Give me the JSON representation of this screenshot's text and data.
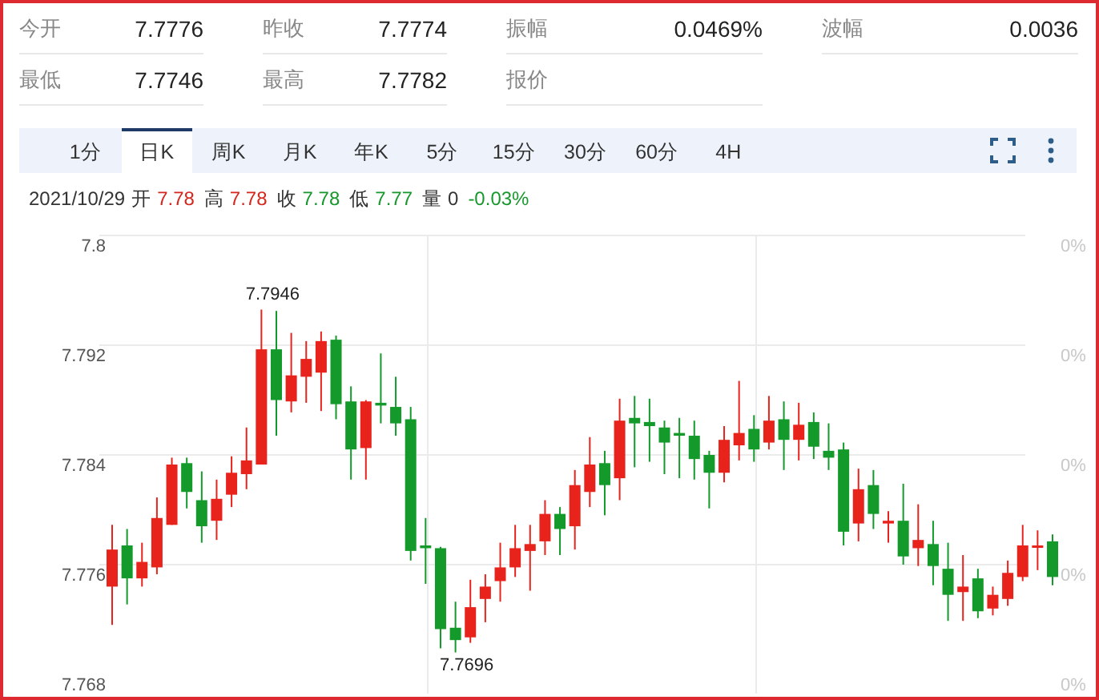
{
  "stats": [
    {
      "label": "今开",
      "value": "7.7776"
    },
    {
      "label": "昨收",
      "value": "7.7774"
    },
    {
      "label": "振幅",
      "value": "0.0469%"
    },
    {
      "label": "波幅",
      "value": "0.0036"
    },
    {
      "label": "最低",
      "value": "7.7746"
    },
    {
      "label": "最高",
      "value": "7.7782"
    },
    {
      "label": "报价"
    }
  ],
  "tabs": [
    {
      "label": "1分",
      "selected": false
    },
    {
      "label": "日K",
      "selected": true
    },
    {
      "label": "周K",
      "selected": false
    },
    {
      "label": "月K",
      "selected": false
    },
    {
      "label": "年K",
      "selected": false
    },
    {
      "label": "5分",
      "selected": false
    },
    {
      "label": "15分",
      "selected": false
    },
    {
      "label": "30分",
      "selected": false
    },
    {
      "label": "60分",
      "selected": false
    },
    {
      "label": "4H",
      "selected": false
    }
  ],
  "info": {
    "date": "2021/10/29",
    "items": [
      {
        "label": "开",
        "value": "7.78",
        "color": "#d4281e"
      },
      {
        "label": "高",
        "value": "7.78",
        "color": "#d4281e"
      },
      {
        "label": "收",
        "value": "7.78",
        "color": "#17982c"
      },
      {
        "label": "低",
        "value": "7.77",
        "color": "#17982c"
      },
      {
        "label": "量",
        "value": "0",
        "color": "#333333"
      },
      {
        "value": "-0.03%",
        "color": "#17982c"
      }
    ]
  },
  "chart": {
    "right_labels": [
      "0%",
      "0%",
      "0%",
      "0%",
      "0%"
    ],
    "chart_data": {
      "type": "candlestick",
      "ylim": [
        7.768,
        7.8
      ],
      "yticks": [
        {
          "value": 7.8,
          "label": "7.8"
        },
        {
          "value": 7.792,
          "label": "7.792"
        },
        {
          "value": 7.784,
          "label": "7.784"
        },
        {
          "value": 7.776,
          "label": "7.776"
        },
        {
          "value": 7.768,
          "label": "7.768"
        }
      ],
      "grid": true,
      "annotations": [
        {
          "text": "7.7946"
        },
        {
          "text": "7.7696"
        }
      ],
      "ohlc": [
        [
          7.7744,
          7.7789,
          7.7716,
          7.7771
        ],
        [
          7.7774,
          7.7786,
          7.7731,
          7.775
        ],
        [
          7.775,
          7.7776,
          7.7744,
          7.7762
        ],
        [
          7.7758,
          7.7809,
          7.7753,
          7.7794
        ],
        [
          7.7789,
          7.7838,
          7.7789,
          7.7833
        ],
        [
          7.7834,
          7.7838,
          7.7801,
          7.7813
        ],
        [
          7.7807,
          7.7828,
          7.7776,
          7.7788
        ],
        [
          7.7792,
          7.7822,
          7.7778,
          7.7808
        ],
        [
          7.7811,
          7.7839,
          7.7802,
          7.7827
        ],
        [
          7.7826,
          7.786,
          7.7815,
          7.7836
        ],
        [
          7.7833,
          7.7946,
          7.7833,
          7.7917
        ],
        [
          7.7917,
          7.7945,
          7.7854,
          7.788
        ],
        [
          7.7879,
          7.7929,
          7.7871,
          7.7898
        ],
        [
          7.7897,
          7.7923,
          7.7878,
          7.791
        ],
        [
          7.79,
          7.793,
          7.7872,
          7.7923
        ],
        [
          7.7924,
          7.7927,
          7.7866,
          7.7877
        ],
        [
          7.7879,
          7.789,
          7.7822,
          7.7844
        ],
        [
          7.7845,
          7.788,
          7.7822,
          7.7879
        ],
        [
          7.7878,
          7.7914,
          7.7863,
          7.7876
        ],
        [
          7.7875,
          7.7897,
          7.7854,
          7.7863
        ],
        [
          7.7866,
          7.7875,
          7.7763,
          7.777
        ],
        [
          7.7774,
          7.7794,
          7.7746,
          7.7772
        ],
        [
          7.7772,
          7.7773,
          7.7699,
          7.7713
        ],
        [
          7.7714,
          7.7733,
          7.7696,
          7.7705
        ],
        [
          7.7707,
          7.7749,
          7.7703,
          7.7729
        ],
        [
          7.7735,
          7.7753,
          7.7718,
          7.7744
        ],
        [
          7.7748,
          7.7776,
          7.7733,
          7.7758
        ],
        [
          7.7758,
          7.7789,
          7.7751,
          7.7772
        ],
        [
          7.777,
          7.7789,
          7.7741,
          7.7775
        ],
        [
          7.7777,
          7.7807,
          7.7767,
          7.7797
        ],
        [
          7.7797,
          7.7802,
          7.7767,
          7.7786
        ],
        [
          7.7788,
          7.7829,
          7.7771,
          7.7818
        ],
        [
          7.7813,
          7.7853,
          7.7802,
          7.7833
        ],
        [
          7.7834,
          7.7843,
          7.7796,
          7.7818
        ],
        [
          7.7823,
          7.7881,
          7.7807,
          7.7865
        ],
        [
          7.7867,
          7.7883,
          7.7831,
          7.7863
        ],
        [
          7.7864,
          7.7881,
          7.7835,
          7.7861
        ],
        [
          7.786,
          7.7865,
          7.7826,
          7.7849
        ],
        [
          7.7856,
          7.7867,
          7.7823,
          7.7854
        ],
        [
          7.7854,
          7.7865,
          7.7822,
          7.7837
        ],
        [
          7.784,
          7.7843,
          7.7801,
          7.7827
        ],
        [
          7.7827,
          7.7861,
          7.782,
          7.7851
        ],
        [
          7.7847,
          7.7894,
          7.7836,
          7.7856
        ],
        [
          7.7859,
          7.7869,
          7.7835,
          7.7844
        ],
        [
          7.7849,
          7.7883,
          7.7844,
          7.7865
        ],
        [
          7.7866,
          7.7879,
          7.7829,
          7.7851
        ],
        [
          7.7851,
          7.7878,
          7.7836,
          7.7862
        ],
        [
          7.7864,
          7.7871,
          7.7837,
          7.7846
        ],
        [
          7.7843,
          7.7863,
          7.7829,
          7.7838
        ],
        [
          7.7844,
          7.7849,
          7.7774,
          7.7784
        ],
        [
          7.779,
          7.783,
          7.7777,
          7.7815
        ],
        [
          7.7818,
          7.7829,
          7.7786,
          7.7797
        ],
        [
          7.779,
          7.7799,
          7.7776,
          7.7792
        ],
        [
          7.7792,
          7.7819,
          7.776,
          7.7766
        ],
        [
          7.7772,
          7.7804,
          7.7759,
          7.7778
        ],
        [
          7.7775,
          7.7792,
          7.7745,
          7.7759
        ],
        [
          7.7757,
          7.7776,
          7.7719,
          7.7738
        ],
        [
          7.774,
          7.7767,
          7.7719,
          7.7744
        ],
        [
          7.775,
          7.7757,
          7.7721,
          7.7726
        ],
        [
          7.7728,
          7.7744,
          7.7723,
          7.7738
        ],
        [
          7.7735,
          7.7763,
          7.773,
          7.7754
        ],
        [
          7.7751,
          7.7789,
          7.7748,
          7.7774
        ],
        [
          7.7773,
          7.7785,
          7.7756,
          7.7774
        ],
        [
          7.7777,
          7.7782,
          7.7745,
          7.7751
        ]
      ]
    }
  }
}
